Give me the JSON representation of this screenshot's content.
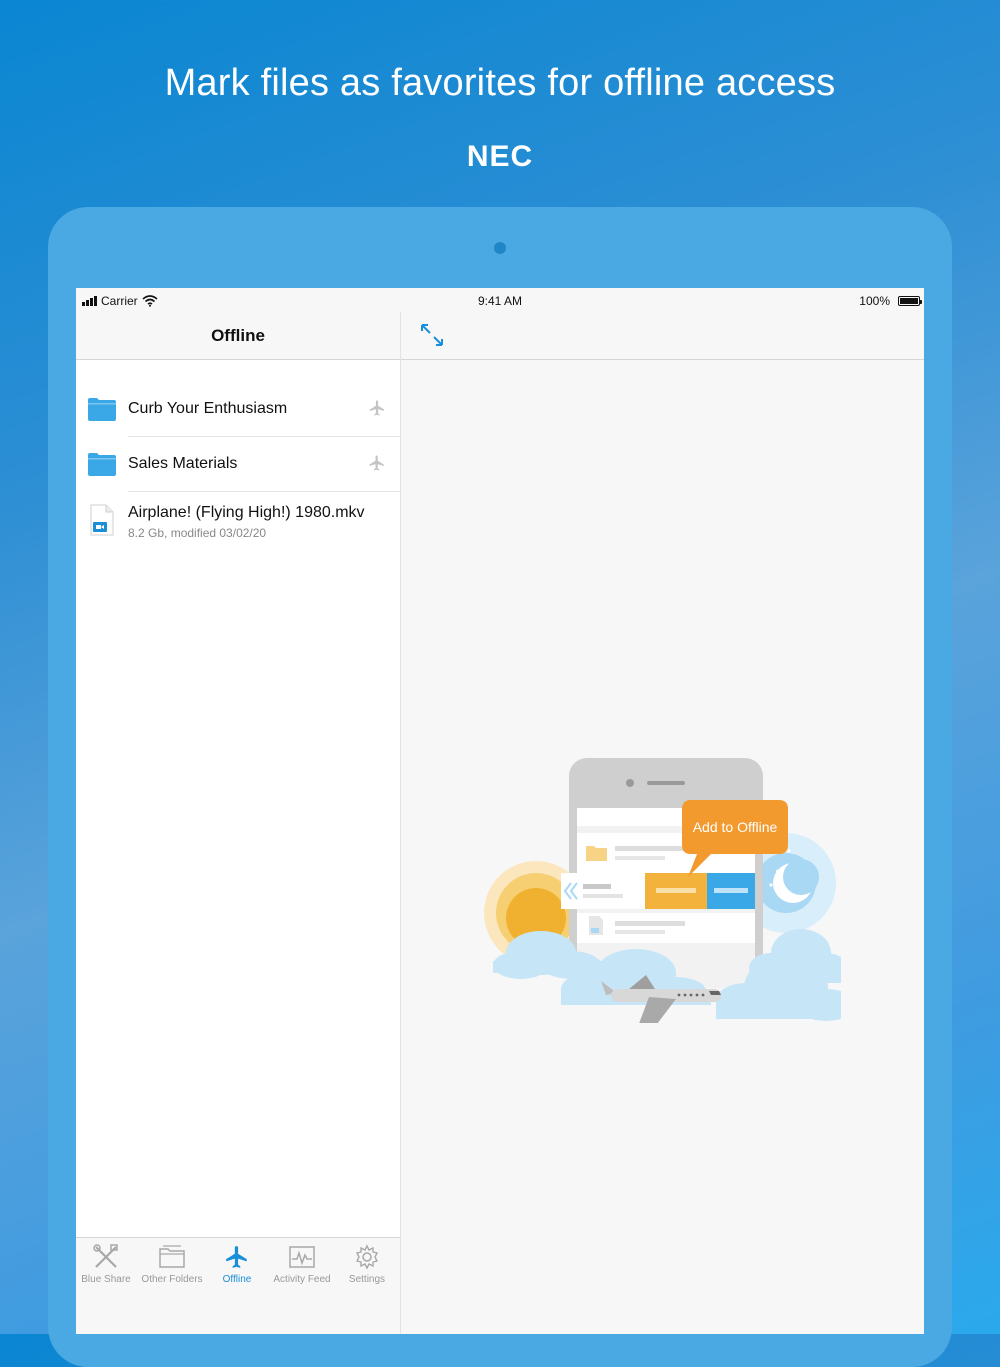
{
  "headline": "Mark files as favorites for offline access",
  "brand": "NEC",
  "status_bar": {
    "carrier": "Carrier",
    "time": "9:41 AM",
    "battery": "100%"
  },
  "sidebar": {
    "title": "Offline",
    "items": [
      {
        "type": "folder",
        "name": "Curb Your Enthusiasm"
      },
      {
        "type": "folder",
        "name": "Sales Materials"
      },
      {
        "type": "file",
        "name": "Airplane! (Flying High!) 1980.mkv",
        "meta": "8.2 Gb, modified 03/02/20"
      }
    ]
  },
  "tabs": [
    {
      "label": "Blue Share",
      "icon": "tools-icon",
      "active": false
    },
    {
      "label": "Other Folders",
      "icon": "folders-icon",
      "active": false
    },
    {
      "label": "Offline",
      "icon": "airplane-icon",
      "active": true
    },
    {
      "label": "Activity Feed",
      "icon": "activity-icon",
      "active": false
    },
    {
      "label": "Settings",
      "icon": "gear-icon",
      "active": false
    }
  ],
  "illustration": {
    "bubble_text": "Add to Offline"
  },
  "colors": {
    "accent": "#1a8fd8",
    "folder": "#3aa7e6",
    "bubble": "#f29a2e"
  }
}
